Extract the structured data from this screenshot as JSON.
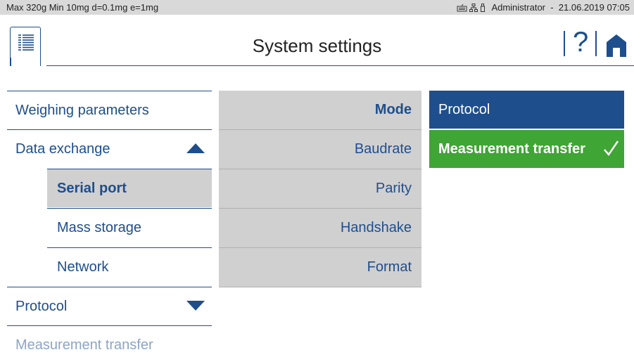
{
  "status_bar": {
    "capacity": "Max 320g  Min 10mg  d=0.1mg  e=1mg",
    "icons": [
      "keyboard-icon",
      "network-icon",
      "usb-icon"
    ],
    "user_datetime": "Administrator  -  21.06.2019 07:05"
  },
  "header": {
    "title": "System settings",
    "menu_icon": "menu-list-icon",
    "help_label": "?",
    "home_icon": "home-icon"
  },
  "left_nav": {
    "items": [
      {
        "label": "Weighing parameters"
      },
      {
        "label": "Data exchange",
        "expanded": true
      },
      {
        "label": "Serial port",
        "selected": true
      },
      {
        "label": "Mass storage"
      },
      {
        "label": "Network"
      },
      {
        "label": "Protocol",
        "expanded": false
      },
      {
        "label": "Measurement transfer"
      }
    ]
  },
  "mid_panel": {
    "items": [
      {
        "label": "Mode",
        "selected": true
      },
      {
        "label": "Baudrate"
      },
      {
        "label": "Parity"
      },
      {
        "label": "Handshake"
      },
      {
        "label": "Format"
      }
    ]
  },
  "options": {
    "items": [
      {
        "label": "Protocol",
        "checked": false
      },
      {
        "label": "Measurement transfer",
        "checked": true
      }
    ]
  },
  "colors": {
    "accent_blue": "#1e4e8c",
    "selected_green": "#3fa535",
    "panel_gray": "#d0d0d0",
    "status_gray": "#d9d9d9"
  }
}
